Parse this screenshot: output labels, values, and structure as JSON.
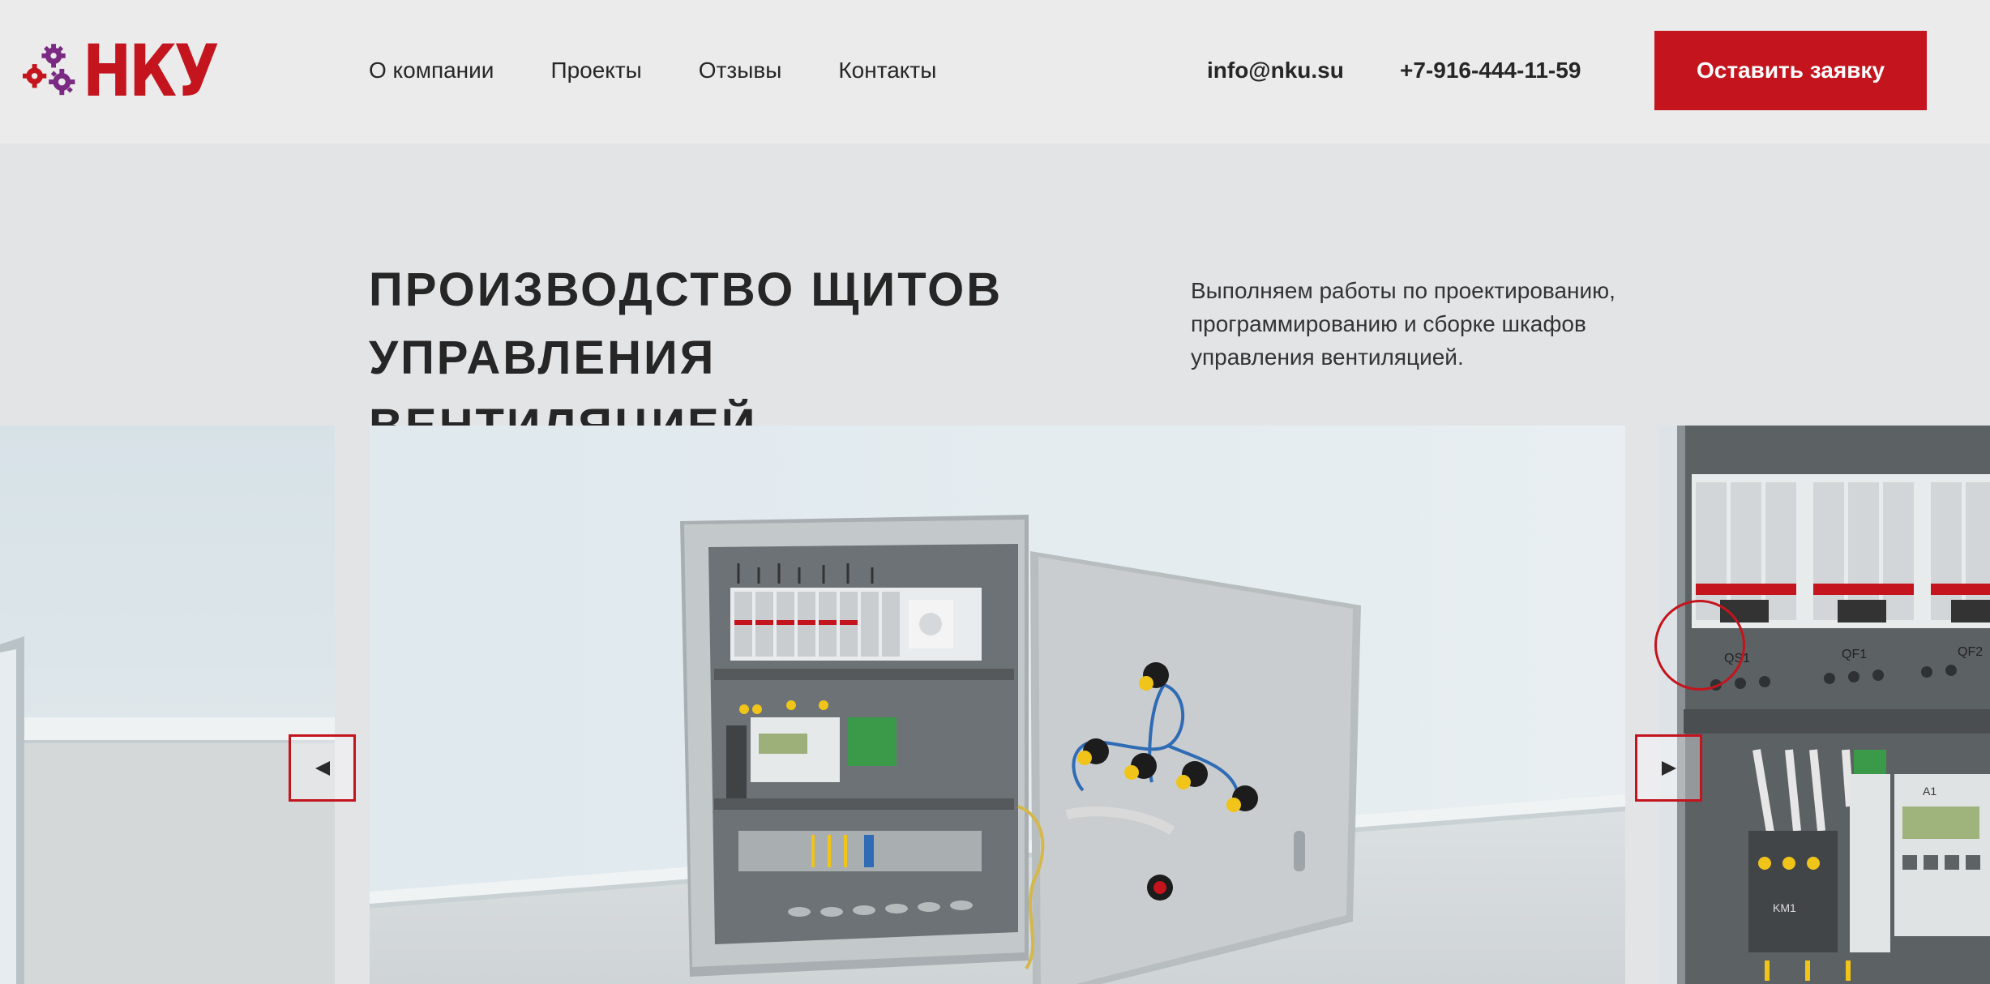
{
  "brand": {
    "logo_text": "НКУ",
    "logo_color": "#c4141d",
    "gear_color": "#7a2a82"
  },
  "nav": {
    "items": [
      {
        "label": "О компании"
      },
      {
        "label": "Проекты"
      },
      {
        "label": "Отзывы"
      },
      {
        "label": "Контакты"
      }
    ]
  },
  "contacts": {
    "email": "info@nku.su",
    "phone": "+7-916-444-11-59"
  },
  "cta": {
    "label": "Оставить заявку",
    "color": "#c4141d"
  },
  "hero": {
    "title_line1": "ПРОИЗВОДСТВО ЩИТОВ",
    "title_line2": "УПРАВЛЕНИЯ ВЕНТИЛЯЦИЕЙ",
    "description": "Выполняем работы по проектированию, программированию и сборке шкафов управления вентиляцией."
  },
  "slider": {
    "prev_icon": "triangle-left-icon",
    "next_icon": "triangle-right-icon",
    "slides": [
      {
        "subject": "wall-and-floor-photo"
      },
      {
        "subject": "open-ventilation-control-cabinet-photo"
      },
      {
        "subject": "cabinet-circuit-breakers-closeup-photo"
      }
    ],
    "breaker_labels": [
      "QS1",
      "QF1",
      "QF2",
      "A1",
      "KM1"
    ]
  }
}
